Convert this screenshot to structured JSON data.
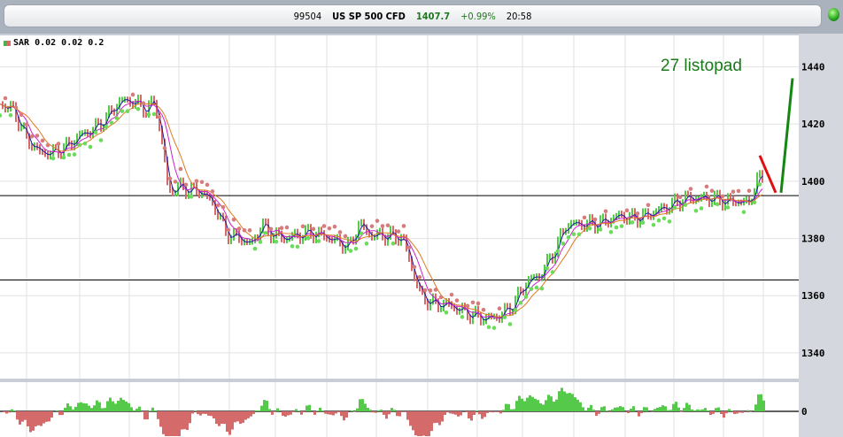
{
  "ticker": {
    "id": "99504",
    "symbol": "US SP 500 CFD",
    "price": "1407.7",
    "change": "+0.99%",
    "time": "20:58"
  },
  "legend": {
    "label": "SAR 0.02 0.02 0.2"
  },
  "annotation": {
    "text": "27 listopad",
    "color": "#1a7a1a"
  },
  "colors": {
    "up": "#55c94a",
    "down": "#d46a6a",
    "ma_fast": "#1a1aa0",
    "ma_mid": "#cc22cc",
    "ma_slow": "#e07a20",
    "sar_up": "#6bdc5a",
    "sar_down": "#d77c7c",
    "arrow_down": "#e01010",
    "arrow_up": "#118811"
  },
  "chart_data": {
    "type": "line",
    "title": "US SP 500 CFD",
    "yaxis_ticks": [
      1340,
      1360,
      1380,
      1400,
      1420,
      1440
    ],
    "ylim": [
      1331,
      1451
    ],
    "osc_zero_label": "0",
    "support_lines": [
      1395,
      1365.5
    ],
    "close": [
      1427,
      1425,
      1415,
      1410,
      1410,
      1412,
      1416,
      1418,
      1422,
      1428,
      1428,
      1425,
      1428,
      1410,
      1396,
      1398,
      1397,
      1396,
      1390,
      1382,
      1380,
      1378,
      1385,
      1382,
      1380,
      1381,
      1382,
      1381,
      1379,
      1377,
      1385,
      1381,
      1381,
      1380,
      1370,
      1360,
      1357,
      1357,
      1355,
      1353,
      1352,
      1353,
      1357,
      1365,
      1367,
      1375,
      1385,
      1385,
      1385,
      1386,
      1388,
      1387,
      1388,
      1390,
      1392,
      1394,
      1394,
      1394,
      1393,
      1393,
      1392,
      1400,
      1402
    ],
    "x_positions": [
      0,
      15,
      30,
      45,
      60,
      75,
      90,
      105,
      120,
      135,
      150,
      165,
      175,
      185,
      190,
      200,
      215,
      230,
      245,
      255,
      270,
      285,
      295,
      305,
      320,
      335,
      350,
      365,
      380,
      395,
      405,
      420,
      440,
      455,
      465,
      475,
      490,
      505,
      520,
      535,
      550,
      565,
      580,
      595,
      610,
      625,
      640,
      655,
      670,
      685,
      700,
      715,
      730,
      745,
      760,
      775,
      790,
      805,
      820,
      835,
      845,
      855,
      862
    ],
    "annotation_down": [
      [
        858,
        1409
      ],
      [
        876,
        1396
      ]
    ],
    "annotation_up": [
      [
        882,
        1396
      ],
      [
        895,
        1436
      ]
    ]
  }
}
